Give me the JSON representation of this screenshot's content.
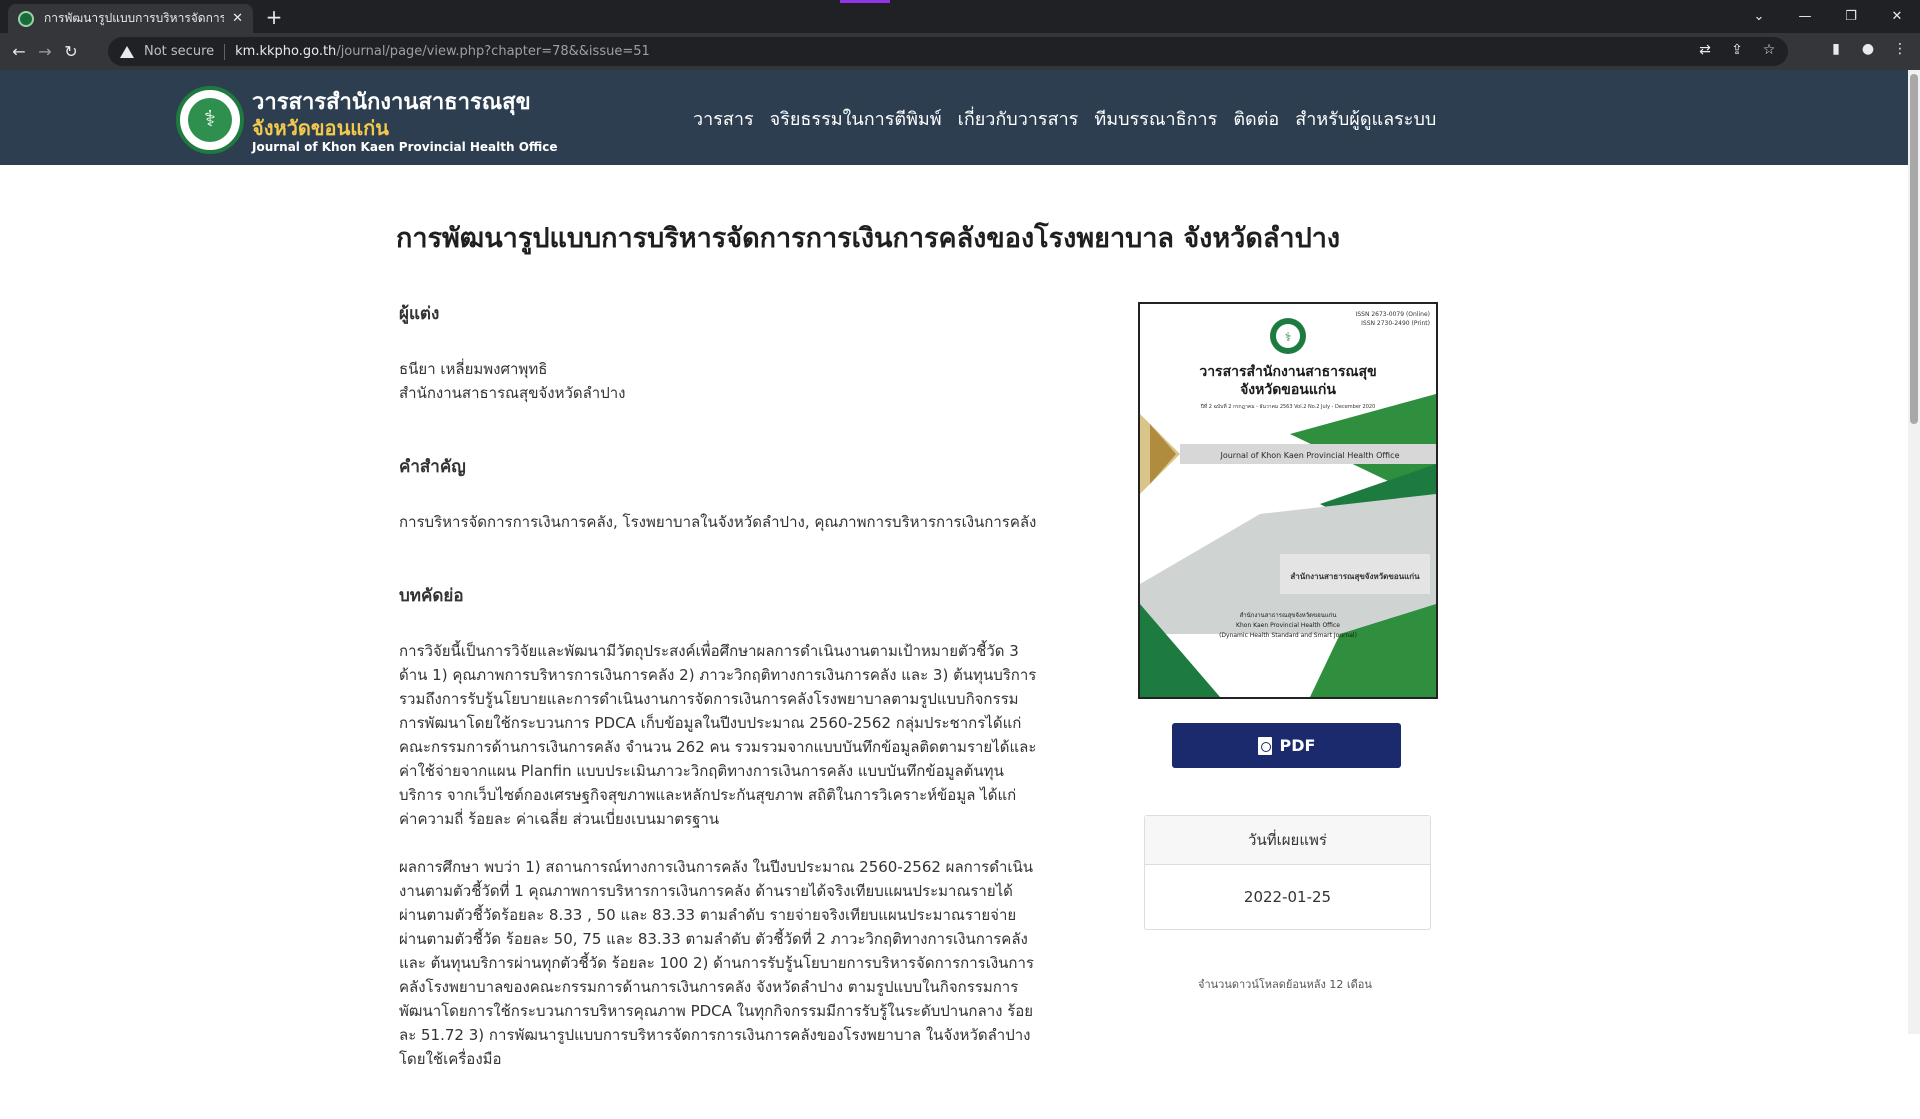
{
  "browser": {
    "tab_title": "การพัฒนารูปแบบการบริหารจัดการการ",
    "tab_close": "✕",
    "new_tab": "+",
    "not_secure": "Not secure",
    "url_host": "km.kkpho.go.th",
    "url_path": "/journal/page/view.php?chapter=78&&issue=51"
  },
  "header": {
    "brand_line1": "วารสารสำนักงานสาธารณสุข",
    "brand_line2": "จังหวัดขอนแก่น",
    "brand_line3": "Journal of Khon Kaen Provincial Health Office",
    "nav": [
      {
        "label": "วารสาร"
      },
      {
        "label": "จริยธรรมในการตีพิมพ์"
      },
      {
        "label": "เกี่ยวกับวารสาร"
      },
      {
        "label": "ทีมบรรณาธิการ"
      },
      {
        "label": "ติดต่อ"
      },
      {
        "label": "สำหรับผู้ดูแลระบบ"
      }
    ]
  },
  "article": {
    "title": "การพัฒนารูปแบบการบริหารจัดการการเงินการคลังของโรงพยาบาล จังหวัดลำปาง",
    "authors_heading": "ผู้แต่ง",
    "author_name": "ธนียา เหลี่ยมพงศาพุทธิ",
    "author_affiliation": "สำนักงานสาธารณสุขจังหวัดลำปาง",
    "keywords_heading": "คำสำคัญ",
    "keywords": "การบริหารจัดการการเงินการคลัง, โรงพยาบาลในจังหวัดลำปาง, คุณภาพการบริหารการเงินการคลัง",
    "abstract_heading": "บทคัดย่อ",
    "abstract_p1": "การวิจัยนี้เป็นการวิจัยและพัฒนามีวัตถุประสงค์เพื่อศึกษาผลการดำเนินงานตามเป้าหมายตัวชี้วัด 3 ด้าน 1) คุณภาพการบริหารการเงินการคลัง 2) ภาวะวิกฤติทางการเงินการคลัง และ 3) ต้นทุนบริการ รวมถึงการรับรู้นโยบายและการดำเนินงานการจัดการเงินการคลังโรงพยาบาลตามรูปแบบกิจกรรมการพัฒนาโดยใช้กระบวนการ PDCA เก็บข้อมูลในปีงบประมาณ 2560-2562 กลุ่มประชากรได้แก่ คณะกรรมการด้านการเงินการคลัง จำนวน 262 คน รวมรวมจากแบบบันทึกข้อมูลติดตามรายได้และค่าใช้จ่ายจากแผน Planfin แบบประเมินภาวะวิกฤติทางการเงินการคลัง แบบบันทึกข้อมูลต้นทุนบริการ จากเว็บไซต์กองเศรษฐกิจสุขภาพและหลักประกันสุขภาพ สถิติในการวิเคราะห์ข้อมูล ได้แก่ ค่าความถี่ ร้อยละ ค่าเฉลี่ย ส่วนเบี่ยงเบนมาตรฐาน",
    "abstract_p2": "ผลการศึกษา พบว่า 1) สถานการณ์ทางการเงินการคลัง ในปีงบประมาณ 2560-2562 ผลการดำเนินงานตามตัวชี้วัดที่ 1 คุณภาพการบริหารการเงินการคลัง ด้านรายได้จริงเทียบแผนประมาณรายได้ ผ่านตามตัวชี้วัดร้อยละ 8.33 , 50 และ 83.33 ตามลำดับ รายจ่ายจริงเทียบแผนประมาณรายจ่าย ผ่านตามตัวชี้วัด ร้อยละ 50, 75 และ 83.33 ตามลำดับ ตัวชี้วัดที่ 2 ภาวะวิกฤติทางการเงินการคลัง และ ต้นทุนบริการผ่านทุกตัวชี้วัด ร้อยละ 100 2) ด้านการรับรู้นโยบายการบริหารจัดการการเงินการคลังโรงพยาบาลของคณะกรรมการด้านการเงินการคลัง จังหวัดลำปาง ตามรูปแบบในกิจกรรมการพัฒนาโดยการใช้กระบวนการบริหารคุณภาพ PDCA ในทุกกิจกรรมมีการรับรู้ในระดับปานกลาง ร้อยละ 51.72 3) การพัฒนารูปแบบการบริหารจัดการการเงินการคลังของโรงพยาบาล ในจังหวัดลำปาง โดยใช้เครื่องมือ"
  },
  "sidebar": {
    "cover": {
      "issn_online": "ISSN 2673-0079 (Online)",
      "issn_print": "ISSN 2730-2490 (Print)",
      "title1": "วารสารสำนักงานสาธารณสุข",
      "title2": "จังหวัดขอนแก่น",
      "issue_line": "ปีที่ 2 ฉบับที่ 2 กรกฎาคม - ธันวาคม 2563 Vol.2 No.2 July - December 2020",
      "journal_en": "Journal of Khon Kaen Provincial Health Office",
      "sign_text": "สำนักงานสาธารณสุขจังหวัดขอนแก่น",
      "footer1": "สำนักงานสาธารณสุขจังหวัดขอนแก่น",
      "footer2": "Khon Kaen Provincial Health Office",
      "footer3": "(Dynamic Health Standard and Smart Journal)"
    },
    "pdf_label": "PDF",
    "published_label": "วันที่เผยแพร่",
    "published_date": "2022-01-25",
    "download_note": "จำนวนดาวน์โหลดย้อนหลัง 12 เดือน"
  }
}
